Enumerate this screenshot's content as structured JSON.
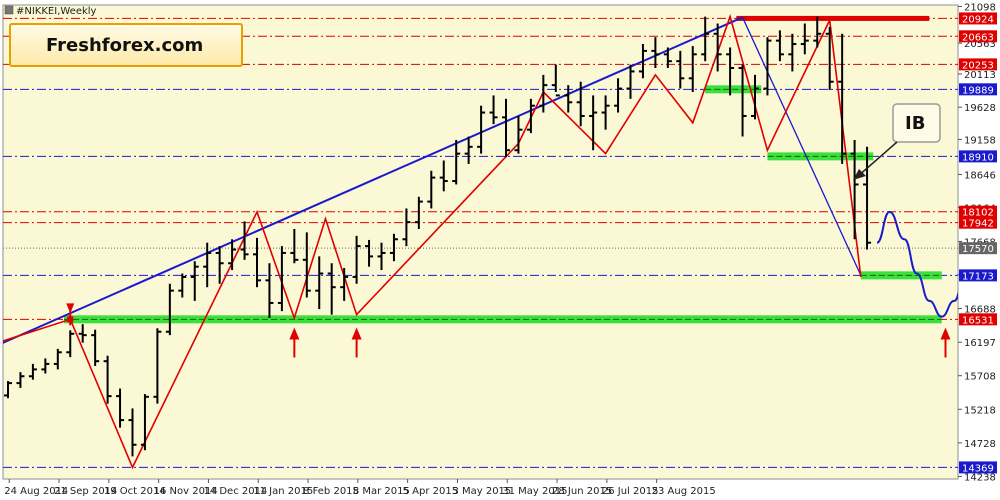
{
  "chart_data": {
    "type": "ohlc",
    "title": "#NIKKEI,Weekly",
    "watermark": "Freshforex.com",
    "annotation": "IB",
    "ylim": [
      14200,
      21120
    ],
    "y_ticks": [
      21098,
      20563,
      20113,
      19628,
      19158,
      18646,
      18164,
      17668,
      17183,
      16688,
      16197,
      15708,
      15218,
      14728,
      14238
    ],
    "x_labels": [
      "24 Aug 2014",
      "21 Sep 2014",
      "19 Oct 2014",
      "16 Nov 2014",
      "14 Dec 2014",
      "11 Jan 2015",
      "8 Feb 2015",
      "8 Mar 2015",
      "5 Apr 2015",
      "3 May 2015",
      "31 May 2015",
      "28 Jun 2015",
      "26 Jul 2015",
      "23 Aug 2015"
    ],
    "levels": [
      {
        "value": 20924,
        "color": "#e00000",
        "label": "20924"
      },
      {
        "value": 20663,
        "color": "#e00000",
        "label": "20663"
      },
      {
        "value": 20253,
        "color": "#e00000",
        "label": "20253"
      },
      {
        "value": 19889,
        "color": "#1a1acc",
        "label": "19889"
      },
      {
        "value": 18910,
        "color": "#1a1acc",
        "label": "18910"
      },
      {
        "value": 18102,
        "color": "#e00000",
        "label": "18102"
      },
      {
        "value": 17942,
        "color": "#e00000",
        "label": "17942"
      },
      {
        "value": 17570,
        "color": "#666666",
        "label": "17570"
      },
      {
        "value": 17173,
        "color": "#1a1acc",
        "label": "17173"
      },
      {
        "value": 16531,
        "color": "#e00000",
        "label": "16531"
      },
      {
        "value": 14369,
        "color": "#1a1acc",
        "label": "14369"
      }
    ],
    "bars": [
      {
        "o": 15420,
        "h": 15630,
        "l": 15380,
        "c": 15600
      },
      {
        "o": 15600,
        "h": 15760,
        "l": 15530,
        "c": 15700
      },
      {
        "o": 15700,
        "h": 15880,
        "l": 15650,
        "c": 15800
      },
      {
        "o": 15800,
        "h": 15960,
        "l": 15740,
        "c": 15880
      },
      {
        "o": 15880,
        "h": 16100,
        "l": 15800,
        "c": 16050
      },
      {
        "o": 16050,
        "h": 16370,
        "l": 15980,
        "c": 16320
      },
      {
        "o": 16320,
        "h": 16460,
        "l": 16190,
        "c": 16300
      },
      {
        "o": 16300,
        "h": 16380,
        "l": 15850,
        "c": 15920
      },
      {
        "o": 15920,
        "h": 16000,
        "l": 15300,
        "c": 15410
      },
      {
        "o": 15410,
        "h": 15520,
        "l": 14950,
        "c": 15060
      },
      {
        "o": 15060,
        "h": 15230,
        "l": 14530,
        "c": 14700
      },
      {
        "o": 14700,
        "h": 15440,
        "l": 14620,
        "c": 15400
      },
      {
        "o": 15400,
        "h": 16400,
        "l": 15300,
        "c": 16350
      },
      {
        "o": 16350,
        "h": 17050,
        "l": 16300,
        "c": 16950
      },
      {
        "o": 16950,
        "h": 17200,
        "l": 16850,
        "c": 17150
      },
      {
        "o": 17150,
        "h": 17380,
        "l": 16800,
        "c": 17300
      },
      {
        "o": 17300,
        "h": 17650,
        "l": 17000,
        "c": 17500
      },
      {
        "o": 17500,
        "h": 17600,
        "l": 17050,
        "c": 17350
      },
      {
        "o": 17350,
        "h": 17700,
        "l": 17250,
        "c": 17550
      },
      {
        "o": 17550,
        "h": 17960,
        "l": 17400,
        "c": 17480
      },
      {
        "o": 17480,
        "h": 17720,
        "l": 17000,
        "c": 17100
      },
      {
        "o": 17100,
        "h": 17350,
        "l": 16550,
        "c": 16770
      },
      {
        "o": 16770,
        "h": 17600,
        "l": 16650,
        "c": 17500
      },
      {
        "o": 17500,
        "h": 17850,
        "l": 17350,
        "c": 17400
      },
      {
        "o": 17400,
        "h": 17800,
        "l": 16850,
        "c": 16950
      },
      {
        "o": 16950,
        "h": 17450,
        "l": 16680,
        "c": 17200
      },
      {
        "o": 17200,
        "h": 17350,
        "l": 16600,
        "c": 17000
      },
      {
        "o": 17000,
        "h": 17280,
        "l": 16800,
        "c": 17150
      },
      {
        "o": 17150,
        "h": 17750,
        "l": 17050,
        "c": 17600
      },
      {
        "o": 17600,
        "h": 17690,
        "l": 17300,
        "c": 17450
      },
      {
        "o": 17450,
        "h": 17650,
        "l": 17250,
        "c": 17500
      },
      {
        "o": 17500,
        "h": 17780,
        "l": 17380,
        "c": 17700
      },
      {
        "o": 17700,
        "h": 18150,
        "l": 17600,
        "c": 17950
      },
      {
        "o": 17950,
        "h": 18320,
        "l": 17850,
        "c": 18250
      },
      {
        "o": 18250,
        "h": 18700,
        "l": 18150,
        "c": 18600
      },
      {
        "o": 18600,
        "h": 18850,
        "l": 18400,
        "c": 18550
      },
      {
        "o": 18550,
        "h": 19150,
        "l": 18500,
        "c": 18950
      },
      {
        "o": 18950,
        "h": 19200,
        "l": 18800,
        "c": 19050
      },
      {
        "o": 19050,
        "h": 19650,
        "l": 18950,
        "c": 19550
      },
      {
        "o": 19550,
        "h": 19800,
        "l": 19380,
        "c": 19480
      },
      {
        "o": 19480,
        "h": 19750,
        "l": 18900,
        "c": 19000
      },
      {
        "o": 19000,
        "h": 19500,
        "l": 18950,
        "c": 19300
      },
      {
        "o": 19300,
        "h": 19750,
        "l": 19250,
        "c": 19650
      },
      {
        "o": 19650,
        "h": 20100,
        "l": 19550,
        "c": 19950
      },
      {
        "o": 19950,
        "h": 20250,
        "l": 19850,
        "c": 19800
      },
      {
        "o": 19800,
        "h": 19950,
        "l": 19550,
        "c": 19700
      },
      {
        "o": 19700,
        "h": 20000,
        "l": 19350,
        "c": 19500
      },
      {
        "o": 19500,
        "h": 19800,
        "l": 19000,
        "c": 19550
      },
      {
        "o": 19550,
        "h": 19800,
        "l": 19300,
        "c": 19650
      },
      {
        "o": 19650,
        "h": 20050,
        "l": 19550,
        "c": 19900
      },
      {
        "o": 19900,
        "h": 20250,
        "l": 19750,
        "c": 20150
      },
      {
        "o": 20150,
        "h": 20550,
        "l": 20050,
        "c": 20450
      },
      {
        "o": 20450,
        "h": 20650,
        "l": 20200,
        "c": 20400
      },
      {
        "o": 20400,
        "h": 20500,
        "l": 20200,
        "c": 20300
      },
      {
        "o": 20300,
        "h": 20450,
        "l": 19900,
        "c": 20050
      },
      {
        "o": 20050,
        "h": 20520,
        "l": 19850,
        "c": 20400
      },
      {
        "o": 20400,
        "h": 20950,
        "l": 20300,
        "c": 20700
      },
      {
        "o": 20700,
        "h": 20850,
        "l": 20150,
        "c": 20400
      },
      {
        "o": 20400,
        "h": 20500,
        "l": 19800,
        "c": 20200
      },
      {
        "o": 20200,
        "h": 20250,
        "l": 19200,
        "c": 19500
      },
      {
        "o": 19500,
        "h": 20100,
        "l": 19450,
        "c": 19900
      },
      {
        "o": 19900,
        "h": 20650,
        "l": 19800,
        "c": 20600
      },
      {
        "o": 20600,
        "h": 20750,
        "l": 20300,
        "c": 20400
      },
      {
        "o": 20400,
        "h": 20700,
        "l": 20150,
        "c": 20550
      },
      {
        "o": 20550,
        "h": 20850,
        "l": 20400,
        "c": 20600
      },
      {
        "o": 20600,
        "h": 20950,
        "l": 20500,
        "c": 20700
      },
      {
        "o": 20700,
        "h": 20800,
        "l": 19880,
        "c": 20000
      },
      {
        "o": 20000,
        "h": 20700,
        "l": 18800,
        "c": 18950
      },
      {
        "o": 18950,
        "h": 19150,
        "l": 17700,
        "c": 18500
      },
      {
        "o": 18500,
        "h": 19050,
        "l": 17550,
        "c": 17650
      }
    ],
    "zigzag": [
      [
        -1.5,
        16150
      ],
      [
        5,
        16531
      ],
      [
        10,
        14369
      ],
      [
        20,
        18100
      ],
      [
        23,
        16550
      ],
      [
        25.5,
        18000
      ],
      [
        28,
        16600
      ],
      [
        41,
        19100
      ],
      [
        43,
        19850
      ],
      [
        48,
        18950
      ],
      [
        52,
        20100
      ],
      [
        55,
        19400
      ],
      [
        58,
        20950
      ],
      [
        61,
        19000
      ],
      [
        66,
        20900
      ],
      [
        68.5,
        17150
      ]
    ],
    "trendlines": [
      {
        "from": [
          -1.5,
          16100
        ],
        "to": [
          59,
          20940
        ],
        "color": "#1a1acc"
      },
      {
        "from": [
          59,
          20940
        ],
        "to": [
          68.5,
          17173
        ],
        "color": "#1a1acc"
      }
    ],
    "zones": [
      {
        "value": 16531,
        "x_from": 4.5,
        "x_to": 75
      },
      {
        "value": 17173,
        "x_from": 68.5,
        "x_to": 75
      },
      {
        "value": 18910,
        "x_from": 61,
        "x_to": 69.5
      },
      {
        "value": 19889,
        "x_from": 56,
        "x_to": 60.5
      }
    ],
    "red_zone": {
      "value": 20924,
      "x_from": 58.5,
      "x_to": 74
    },
    "arrows_up": [
      [
        23,
        16500
      ],
      [
        28,
        16500
      ],
      [
        75.3,
        16500
      ]
    ],
    "forecast": [
      [
        69.8,
        17650
      ],
      [
        70.8,
        18100
      ],
      [
        72,
        17700
      ],
      [
        73,
        17200
      ],
      [
        74,
        16800
      ],
      [
        75,
        16570
      ],
      [
        76,
        16800
      ],
      [
        77,
        17300
      ],
      [
        78,
        17900
      ]
    ]
  }
}
